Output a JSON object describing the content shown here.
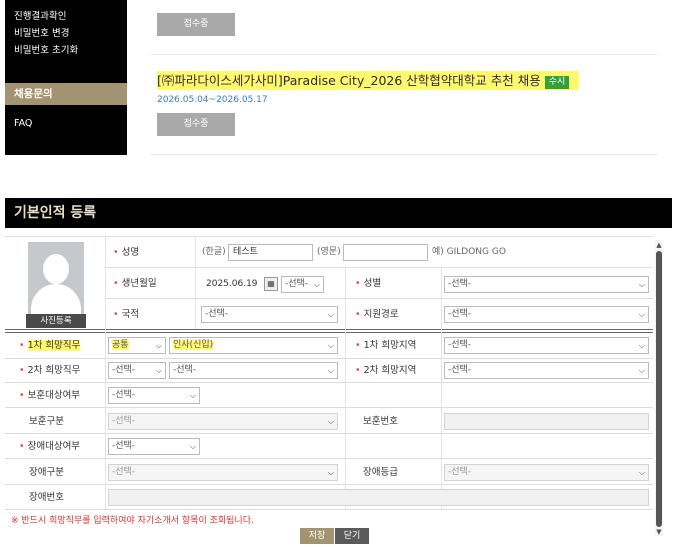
{
  "sidebar": {
    "items": [
      {
        "label": "진행결과확인"
      },
      {
        "label": "비밀번호 변경"
      },
      {
        "label": "비밀번호 초기화"
      }
    ],
    "active_section": "채용문의",
    "faq": "FAQ"
  },
  "jobs": {
    "first": {
      "status": "접수중"
    },
    "second": {
      "title": "[㈜파라다이스세가사미]Paradise City_2026 산학협약대학교 추천 채용",
      "badge": "수시",
      "period": "2026.05.04~2026.05.17",
      "status": "접수중"
    }
  },
  "form": {
    "section_title": "기본인적 등록",
    "photo_button": "사진등록",
    "name": {
      "label": "성명",
      "korean_prefix": "(한글)",
      "korean_value": "테스트",
      "english_prefix": "(영문)",
      "english_value": "",
      "example": "예) GILDONG GO"
    },
    "birth": {
      "label": "생년월일",
      "value": "2025.06.19",
      "calendar_select": "-선택-"
    },
    "gender": {
      "label": "성별",
      "value": "-선택-"
    },
    "nationality": {
      "label": "국적",
      "value": "-선택-"
    },
    "route": {
      "label": "지원경로",
      "value": "-선택-"
    },
    "job1": {
      "label": "1차 희망직무",
      "category": "공통",
      "role": "인사(신입)"
    },
    "region1": {
      "label": "1차 희망지역",
      "value": "-선택-"
    },
    "job2": {
      "label": "2차 희망직무",
      "category": "-선택-",
      "role": "-선택-"
    },
    "region2": {
      "label": "2차 희망지역",
      "value": "-선택-"
    },
    "veteran_target": {
      "label": "보훈대상여부",
      "value": "-선택-"
    },
    "veteran_type": {
      "label": "보훈구분",
      "value": "-선택-"
    },
    "veteran_number": {
      "label": "보훈번호",
      "value": ""
    },
    "disability_target": {
      "label": "장애대상여부",
      "value": "-선택-"
    },
    "disability_type": {
      "label": "장애구분",
      "value": "-선택-"
    },
    "disability_grade": {
      "label": "장애등급",
      "value": "-선택-"
    },
    "disability_number": {
      "label": "장애번호",
      "value": ""
    },
    "notice": "※ 반드시 희망직무를 입력하여야 자기소개서 항목이 조회됩니다.",
    "save_label": "저장",
    "close_label": "닫기"
  },
  "colors": {
    "sidebar_bg": "#000000",
    "active_tab": "#a39371",
    "highlight": "#fff76e",
    "badge": "#2fa23a",
    "required_star": "#d9534f",
    "notice": "#e0312f"
  }
}
